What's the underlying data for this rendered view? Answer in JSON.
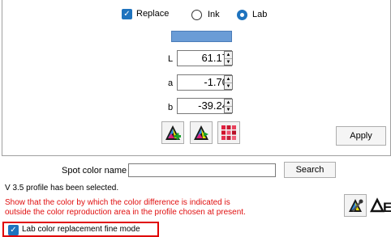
{
  "mode": {
    "replace_label": "Replace",
    "ink_label": "Ink",
    "lab_label": "Lab",
    "selected": "Lab"
  },
  "swatch_color": "#6a9cd6",
  "lab_fields": [
    {
      "label": "L",
      "value": "61.17"
    },
    {
      "label": "a",
      "value": "-1.70"
    },
    {
      "label": "b",
      "value": "-39.24"
    }
  ],
  "icons": [
    "profile-add-icon",
    "profile-replace-icon",
    "color-grid-icon",
    "color-picker-icon",
    "delta-e-icon"
  ],
  "apply_label": "Apply",
  "spot": {
    "label": "Spot color name",
    "value": "",
    "search_label": "Search"
  },
  "status_text": "V 3.5 profile has been selected.",
  "warning_line1": "Show that the color by which the color difference is indicated is",
  "warning_line2": "outside the color reproduction area in the profile chosen at present.",
  "fine_mode_label": "Lab color replacement fine mode",
  "colors": {
    "accent": "#1e73be",
    "warning": "#e01010",
    "highlight_border": "#e00000"
  }
}
